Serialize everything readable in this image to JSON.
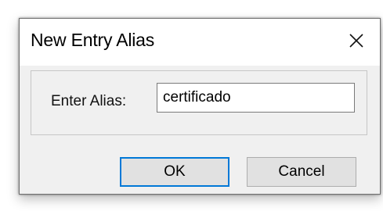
{
  "dialog": {
    "title": "New Entry Alias",
    "close_icon": "close-icon"
  },
  "form": {
    "alias_label": "Enter Alias:",
    "alias_value": "certificado"
  },
  "buttons": {
    "ok_label": "OK",
    "cancel_label": "Cancel"
  },
  "colors": {
    "dialog_background": "#f0f0f0",
    "titlebar_background": "#ffffff",
    "default_button_border": "#0078d7"
  }
}
